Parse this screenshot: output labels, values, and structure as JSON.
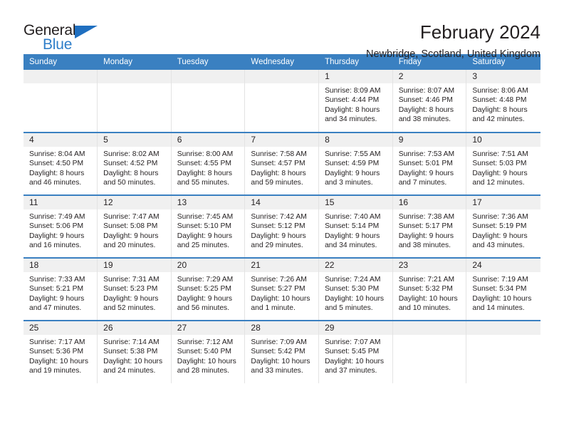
{
  "logo": {
    "word1": "General",
    "word2": "Blue",
    "triangle_color": "#1f6fc0",
    "blue_color": "#2e7ec9"
  },
  "header": {
    "month_title": "February 2024",
    "location": "Newbridge, Scotland, United Kingdom",
    "header_bg": "#3a80c1"
  },
  "calendar": {
    "weekday_headers": [
      "Sunday",
      "Monday",
      "Tuesday",
      "Wednesday",
      "Thursday",
      "Friday",
      "Saturday"
    ],
    "weeks": [
      [
        {
          "day": "",
          "lines": []
        },
        {
          "day": "",
          "lines": []
        },
        {
          "day": "",
          "lines": []
        },
        {
          "day": "",
          "lines": []
        },
        {
          "day": "1",
          "lines": [
            "Sunrise: 8:09 AM",
            "Sunset: 4:44 PM",
            "Daylight: 8 hours",
            "and 34 minutes."
          ]
        },
        {
          "day": "2",
          "lines": [
            "Sunrise: 8:07 AM",
            "Sunset: 4:46 PM",
            "Daylight: 8 hours",
            "and 38 minutes."
          ]
        },
        {
          "day": "3",
          "lines": [
            "Sunrise: 8:06 AM",
            "Sunset: 4:48 PM",
            "Daylight: 8 hours",
            "and 42 minutes."
          ]
        }
      ],
      [
        {
          "day": "4",
          "lines": [
            "Sunrise: 8:04 AM",
            "Sunset: 4:50 PM",
            "Daylight: 8 hours",
            "and 46 minutes."
          ]
        },
        {
          "day": "5",
          "lines": [
            "Sunrise: 8:02 AM",
            "Sunset: 4:52 PM",
            "Daylight: 8 hours",
            "and 50 minutes."
          ]
        },
        {
          "day": "6",
          "lines": [
            "Sunrise: 8:00 AM",
            "Sunset: 4:55 PM",
            "Daylight: 8 hours",
            "and 55 minutes."
          ]
        },
        {
          "day": "7",
          "lines": [
            "Sunrise: 7:58 AM",
            "Sunset: 4:57 PM",
            "Daylight: 8 hours",
            "and 59 minutes."
          ]
        },
        {
          "day": "8",
          "lines": [
            "Sunrise: 7:55 AM",
            "Sunset: 4:59 PM",
            "Daylight: 9 hours",
            "and 3 minutes."
          ]
        },
        {
          "day": "9",
          "lines": [
            "Sunrise: 7:53 AM",
            "Sunset: 5:01 PM",
            "Daylight: 9 hours",
            "and 7 minutes."
          ]
        },
        {
          "day": "10",
          "lines": [
            "Sunrise: 7:51 AM",
            "Sunset: 5:03 PM",
            "Daylight: 9 hours",
            "and 12 minutes."
          ]
        }
      ],
      [
        {
          "day": "11",
          "lines": [
            "Sunrise: 7:49 AM",
            "Sunset: 5:06 PM",
            "Daylight: 9 hours",
            "and 16 minutes."
          ]
        },
        {
          "day": "12",
          "lines": [
            "Sunrise: 7:47 AM",
            "Sunset: 5:08 PM",
            "Daylight: 9 hours",
            "and 20 minutes."
          ]
        },
        {
          "day": "13",
          "lines": [
            "Sunrise: 7:45 AM",
            "Sunset: 5:10 PM",
            "Daylight: 9 hours",
            "and 25 minutes."
          ]
        },
        {
          "day": "14",
          "lines": [
            "Sunrise: 7:42 AM",
            "Sunset: 5:12 PM",
            "Daylight: 9 hours",
            "and 29 minutes."
          ]
        },
        {
          "day": "15",
          "lines": [
            "Sunrise: 7:40 AM",
            "Sunset: 5:14 PM",
            "Daylight: 9 hours",
            "and 34 minutes."
          ]
        },
        {
          "day": "16",
          "lines": [
            "Sunrise: 7:38 AM",
            "Sunset: 5:17 PM",
            "Daylight: 9 hours",
            "and 38 minutes."
          ]
        },
        {
          "day": "17",
          "lines": [
            "Sunrise: 7:36 AM",
            "Sunset: 5:19 PM",
            "Daylight: 9 hours",
            "and 43 minutes."
          ]
        }
      ],
      [
        {
          "day": "18",
          "lines": [
            "Sunrise: 7:33 AM",
            "Sunset: 5:21 PM",
            "Daylight: 9 hours",
            "and 47 minutes."
          ]
        },
        {
          "day": "19",
          "lines": [
            "Sunrise: 7:31 AM",
            "Sunset: 5:23 PM",
            "Daylight: 9 hours",
            "and 52 minutes."
          ]
        },
        {
          "day": "20",
          "lines": [
            "Sunrise: 7:29 AM",
            "Sunset: 5:25 PM",
            "Daylight: 9 hours",
            "and 56 minutes."
          ]
        },
        {
          "day": "21",
          "lines": [
            "Sunrise: 7:26 AM",
            "Sunset: 5:27 PM",
            "Daylight: 10 hours",
            "and 1 minute."
          ]
        },
        {
          "day": "22",
          "lines": [
            "Sunrise: 7:24 AM",
            "Sunset: 5:30 PM",
            "Daylight: 10 hours",
            "and 5 minutes."
          ]
        },
        {
          "day": "23",
          "lines": [
            "Sunrise: 7:21 AM",
            "Sunset: 5:32 PM",
            "Daylight: 10 hours",
            "and 10 minutes."
          ]
        },
        {
          "day": "24",
          "lines": [
            "Sunrise: 7:19 AM",
            "Sunset: 5:34 PM",
            "Daylight: 10 hours",
            "and 14 minutes."
          ]
        }
      ],
      [
        {
          "day": "25",
          "lines": [
            "Sunrise: 7:17 AM",
            "Sunset: 5:36 PM",
            "Daylight: 10 hours",
            "and 19 minutes."
          ]
        },
        {
          "day": "26",
          "lines": [
            "Sunrise: 7:14 AM",
            "Sunset: 5:38 PM",
            "Daylight: 10 hours",
            "and 24 minutes."
          ]
        },
        {
          "day": "27",
          "lines": [
            "Sunrise: 7:12 AM",
            "Sunset: 5:40 PM",
            "Daylight: 10 hours",
            "and 28 minutes."
          ]
        },
        {
          "day": "28",
          "lines": [
            "Sunrise: 7:09 AM",
            "Sunset: 5:42 PM",
            "Daylight: 10 hours",
            "and 33 minutes."
          ]
        },
        {
          "day": "29",
          "lines": [
            "Sunrise: 7:07 AM",
            "Sunset: 5:45 PM",
            "Daylight: 10 hours",
            "and 37 minutes."
          ]
        },
        {
          "day": "",
          "lines": []
        },
        {
          "day": "",
          "lines": []
        }
      ]
    ]
  }
}
